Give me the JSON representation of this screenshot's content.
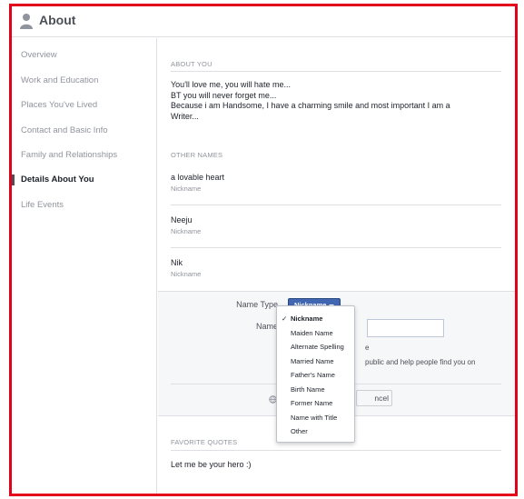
{
  "header": {
    "title": "About"
  },
  "sidebar": {
    "items": [
      {
        "label": "Overview"
      },
      {
        "label": "Work and Education"
      },
      {
        "label": "Places You've Lived"
      },
      {
        "label": "Contact and Basic Info"
      },
      {
        "label": "Family and Relationships"
      },
      {
        "label": "Details About You"
      },
      {
        "label": "Life Events"
      }
    ]
  },
  "about_you": {
    "title": "ABOUT YOU",
    "lines": [
      "You'll love me, you will hate me...",
      "BT you will never forget me...",
      "Because i am Handsome, I have a charming smile and most important I am a",
      "Writer..."
    ]
  },
  "other_names": {
    "title": "OTHER NAMES",
    "entries": [
      {
        "name": "a lovable heart",
        "type": "Nickname"
      },
      {
        "name": "Neeju",
        "type": "Nickname"
      },
      {
        "name": "Nik",
        "type": "Nickname"
      }
    ]
  },
  "form": {
    "name_type_label": "Name Type",
    "name_label": "Name",
    "selected_type": "Nickname",
    "partial_checkbox_text": "e",
    "partial_help_text": "public and help people find you on",
    "cancel_label": "ncel"
  },
  "dropdown": {
    "options": [
      {
        "label": "Nickname",
        "checked": true
      },
      {
        "label": "Maiden Name"
      },
      {
        "label": "Alternate Spelling"
      },
      {
        "label": "Married Name"
      },
      {
        "label": "Father's Name"
      },
      {
        "label": "Birth Name"
      },
      {
        "label": "Former Name"
      },
      {
        "label": "Name with Title"
      },
      {
        "label": "Other"
      }
    ],
    "check_glyph": "✓"
  },
  "favorite_quotes": {
    "title": "FAVORITE QUOTES",
    "text": "Let me be your hero :)"
  },
  "colors": {
    "accent": "#4267b2",
    "frame": "#e3001b"
  }
}
